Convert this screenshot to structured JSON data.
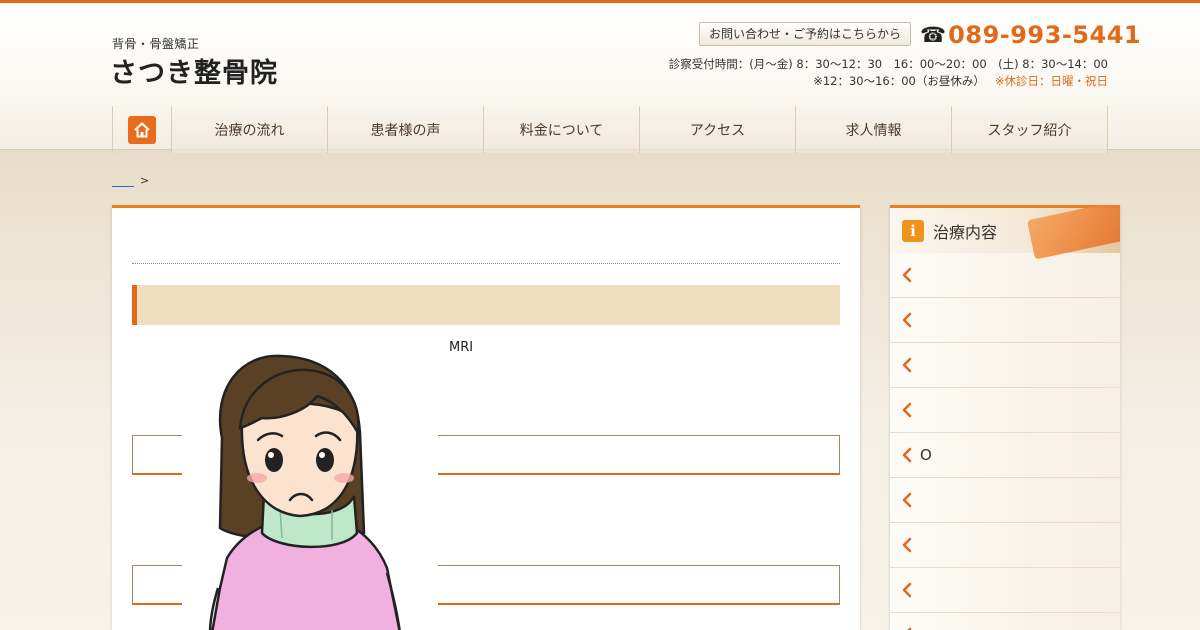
{
  "header": {
    "tagline": "背骨・骨盤矯正",
    "clinic_name": "さつき整骨院",
    "contact_button": "お問い合わせ・ご予約はこちらから",
    "phone_icon": "phone-icon",
    "phone_number": "089-993-5441",
    "hours_line1": "診察受付時間：(月〜金) 8：30〜12：30　16：00〜20：00　(土) 8：30〜14：00",
    "hours_line2": "※12：30〜16：00（お昼休み）",
    "holiday": "※休診日：日曜・祝日"
  },
  "nav": {
    "home_icon": "home-icon",
    "items": [
      {
        "label": "治療の流れ"
      },
      {
        "label": "患者様の声"
      },
      {
        "label": "料金について"
      },
      {
        "label": "アクセス"
      },
      {
        "label": "求人情報"
      },
      {
        "label": "スタッフ紹介"
      }
    ]
  },
  "breadcrumb": {
    "separator": ">"
  },
  "main": {
    "mri_text": "MRI"
  },
  "sidebar": {
    "title": "治療内容",
    "items": [
      {
        "label": ""
      },
      {
        "label": ""
      },
      {
        "label": ""
      },
      {
        "label": ""
      },
      {
        "label": "O"
      },
      {
        "label": ""
      },
      {
        "label": ""
      },
      {
        "label": ""
      },
      {
        "label": ""
      }
    ]
  },
  "colors": {
    "accent": "#e06a1a",
    "band": "#efdfc0"
  }
}
